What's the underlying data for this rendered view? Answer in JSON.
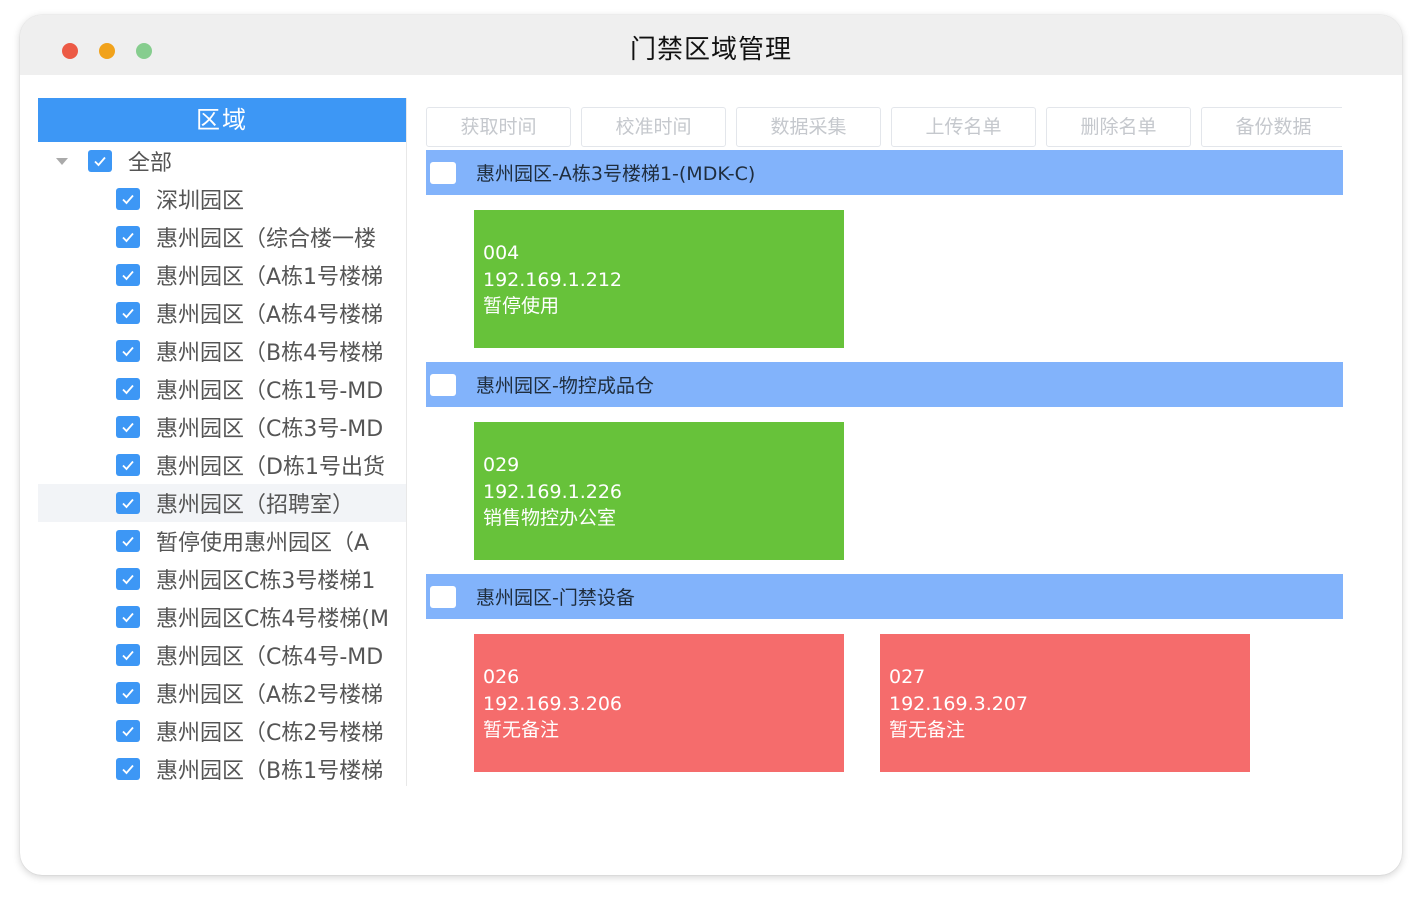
{
  "window": {
    "title": "门禁区域管理",
    "colors": {
      "close": "#ec5a45",
      "minimize": "#f1a21b",
      "maximize": "#86cd8e"
    }
  },
  "sidebar": {
    "header": "区域",
    "root": {
      "label": "全部",
      "checked": true,
      "expanded": true
    },
    "items": [
      {
        "label": "深圳园区",
        "checked": true
      },
      {
        "label": "惠州园区（综合楼一楼",
        "checked": true
      },
      {
        "label": "惠州园区（A栋1号楼梯",
        "checked": true
      },
      {
        "label": "惠州园区（A栋4号楼梯",
        "checked": true
      },
      {
        "label": "惠州园区（B栋4号楼梯",
        "checked": true
      },
      {
        "label": "惠州园区（C栋1号-MD",
        "checked": true
      },
      {
        "label": "惠州园区（C栋3号-MD",
        "checked": true
      },
      {
        "label": "惠州园区（D栋1号出货",
        "checked": true
      },
      {
        "label": "惠州园区（招聘室）",
        "checked": true
      },
      {
        "label": "暂停使用惠州园区（A",
        "checked": true
      },
      {
        "label": "惠州园区C栋3号楼梯1",
        "checked": true
      },
      {
        "label": "惠州园区C栋4号楼梯(M",
        "checked": true
      },
      {
        "label": "惠州园区（C栋4号-MD",
        "checked": true
      },
      {
        "label": "惠州园区（A栋2号楼梯",
        "checked": true
      },
      {
        "label": "惠州园区（C栋2号楼梯",
        "checked": true
      },
      {
        "label": "惠州园区（B栋1号楼梯",
        "checked": true
      }
    ]
  },
  "toolbar": {
    "buttons": [
      "获取时间",
      "校准时间",
      "数据采集",
      "上传名单",
      "删除名单",
      "备份数据"
    ]
  },
  "groups": [
    {
      "title": "惠州园区-A栋3号楼梯1-(MDK-C)",
      "devices": [
        {
          "id": "004",
          "ip": "192.169.1.212",
          "note": "暂停使用",
          "status": "online",
          "color": "#67c23a"
        }
      ]
    },
    {
      "title": "惠州园区-物控成品仓",
      "devices": [
        {
          "id": "029",
          "ip": "192.169.1.226",
          "note": "销售物控办公室",
          "status": "online",
          "color": "#67c23a"
        }
      ]
    },
    {
      "title": "惠州园区-门禁设备",
      "devices": [
        {
          "id": "026",
          "ip": "192.169.3.206",
          "note": "暂无备注",
          "status": "offline",
          "color": "#f56c6c"
        },
        {
          "id": "027",
          "ip": "192.169.3.207",
          "note": "暂无备注",
          "status": "offline",
          "color": "#f56c6c"
        }
      ]
    }
  ],
  "colors": {
    "accent": "#3d97f5",
    "group_bar": "#82b3fb",
    "online": "#67c23a",
    "offline": "#f56c6c"
  }
}
